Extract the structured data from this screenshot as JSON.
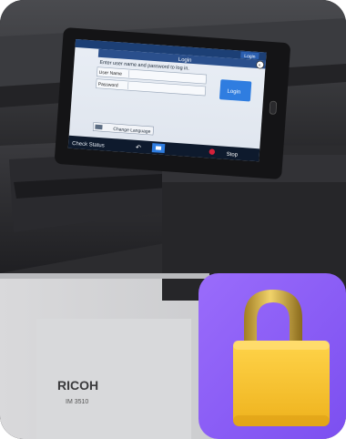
{
  "screen": {
    "login_title": "Login",
    "instruction": "Enter user name and password to log in.",
    "user_name_label": "User Name",
    "password_label": "Password",
    "login_button": "Login",
    "top_login_tab": "Login",
    "change_language": "Change Language",
    "check_status": "Check Status",
    "stop": "Stop"
  },
  "printer": {
    "brand": "RICOH",
    "model": "IM 3510"
  },
  "badge": {
    "icon": "padlock-icon",
    "bg_color": "#8b5cf6",
    "lock_color": "#f5c02a"
  }
}
